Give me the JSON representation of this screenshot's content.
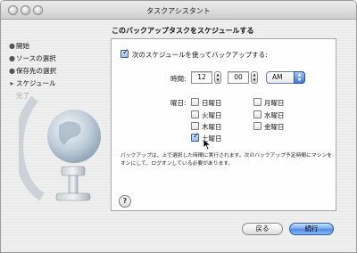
{
  "window": {
    "title": "タスクアシスタント"
  },
  "sidebar": {
    "steps": [
      {
        "label": "開始",
        "state": "done"
      },
      {
        "label": "ソースの選択",
        "state": "done"
      },
      {
        "label": "保存先の選択",
        "state": "done"
      },
      {
        "label": "スケジュール",
        "state": "current"
      },
      {
        "label": "完了",
        "state": "pending"
      }
    ]
  },
  "main": {
    "heading": "このバックアップタスクをスケジュールする",
    "schedule_checkbox": {
      "label": "次のスケジュールを使ってバックアップする:",
      "checked": true
    },
    "time": {
      "label": "時間:",
      "hour": "12",
      "minute": "00",
      "ampm": "AM"
    },
    "days": {
      "label": "曜日:",
      "items": [
        {
          "label": "日曜日",
          "checked": false
        },
        {
          "label": "月曜日",
          "checked": false
        },
        {
          "label": "火曜日",
          "checked": false
        },
        {
          "label": "水曜日",
          "checked": false
        },
        {
          "label": "木曜日",
          "checked": false
        },
        {
          "label": "金曜日",
          "checked": false
        },
        {
          "label": "土曜日",
          "checked": true
        }
      ]
    },
    "note": "バックアップは、上で選択した時間に実行されます。次のバックアップ予定時間にマシンをオンにして、ログオンしている必要があります。",
    "help_label": "?"
  },
  "buttons": {
    "back": "戻る",
    "next": "続行"
  },
  "colors": {
    "accent": "#4a8be2",
    "checkbox_checked": "#9fbde8"
  }
}
